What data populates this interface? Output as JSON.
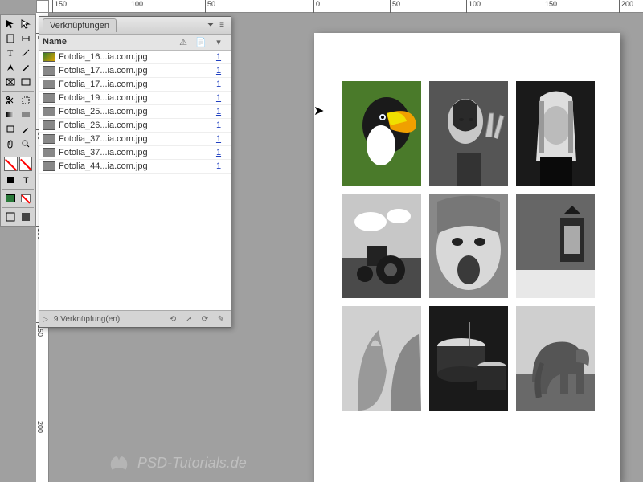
{
  "ruler": {
    "h": [
      "150",
      "100",
      "50",
      "0",
      "50",
      "100",
      "150",
      "200"
    ],
    "v": [
      "0",
      "50",
      "100",
      "150",
      "200"
    ]
  },
  "panel": {
    "tab_label": "Verknüpfungen",
    "header": {
      "name": "Name"
    },
    "rows": [
      {
        "fname": "Fotolia_16...ia.com.jpg",
        "page": "1",
        "color": true
      },
      {
        "fname": "Fotolia_17...ia.com.jpg",
        "page": "1",
        "color": false
      },
      {
        "fname": "Fotolia_17...ia.com.jpg",
        "page": "1",
        "color": false
      },
      {
        "fname": "Fotolia_19...ia.com.jpg",
        "page": "1",
        "color": false
      },
      {
        "fname": "Fotolia_25...ia.com.jpg",
        "page": "1",
        "color": false
      },
      {
        "fname": "Fotolia_26...ia.com.jpg",
        "page": "1",
        "color": false
      },
      {
        "fname": "Fotolia_37...ia.com.jpg",
        "page": "1",
        "color": false
      },
      {
        "fname": "Fotolia_37...ia.com.jpg",
        "page": "1",
        "color": false
      },
      {
        "fname": "Fotolia_44...ia.com.jpg",
        "page": "1",
        "color": false
      }
    ],
    "footer_text": "9 Verknüpfung(en)"
  },
  "watermark": "PSD-Tutorials.de"
}
